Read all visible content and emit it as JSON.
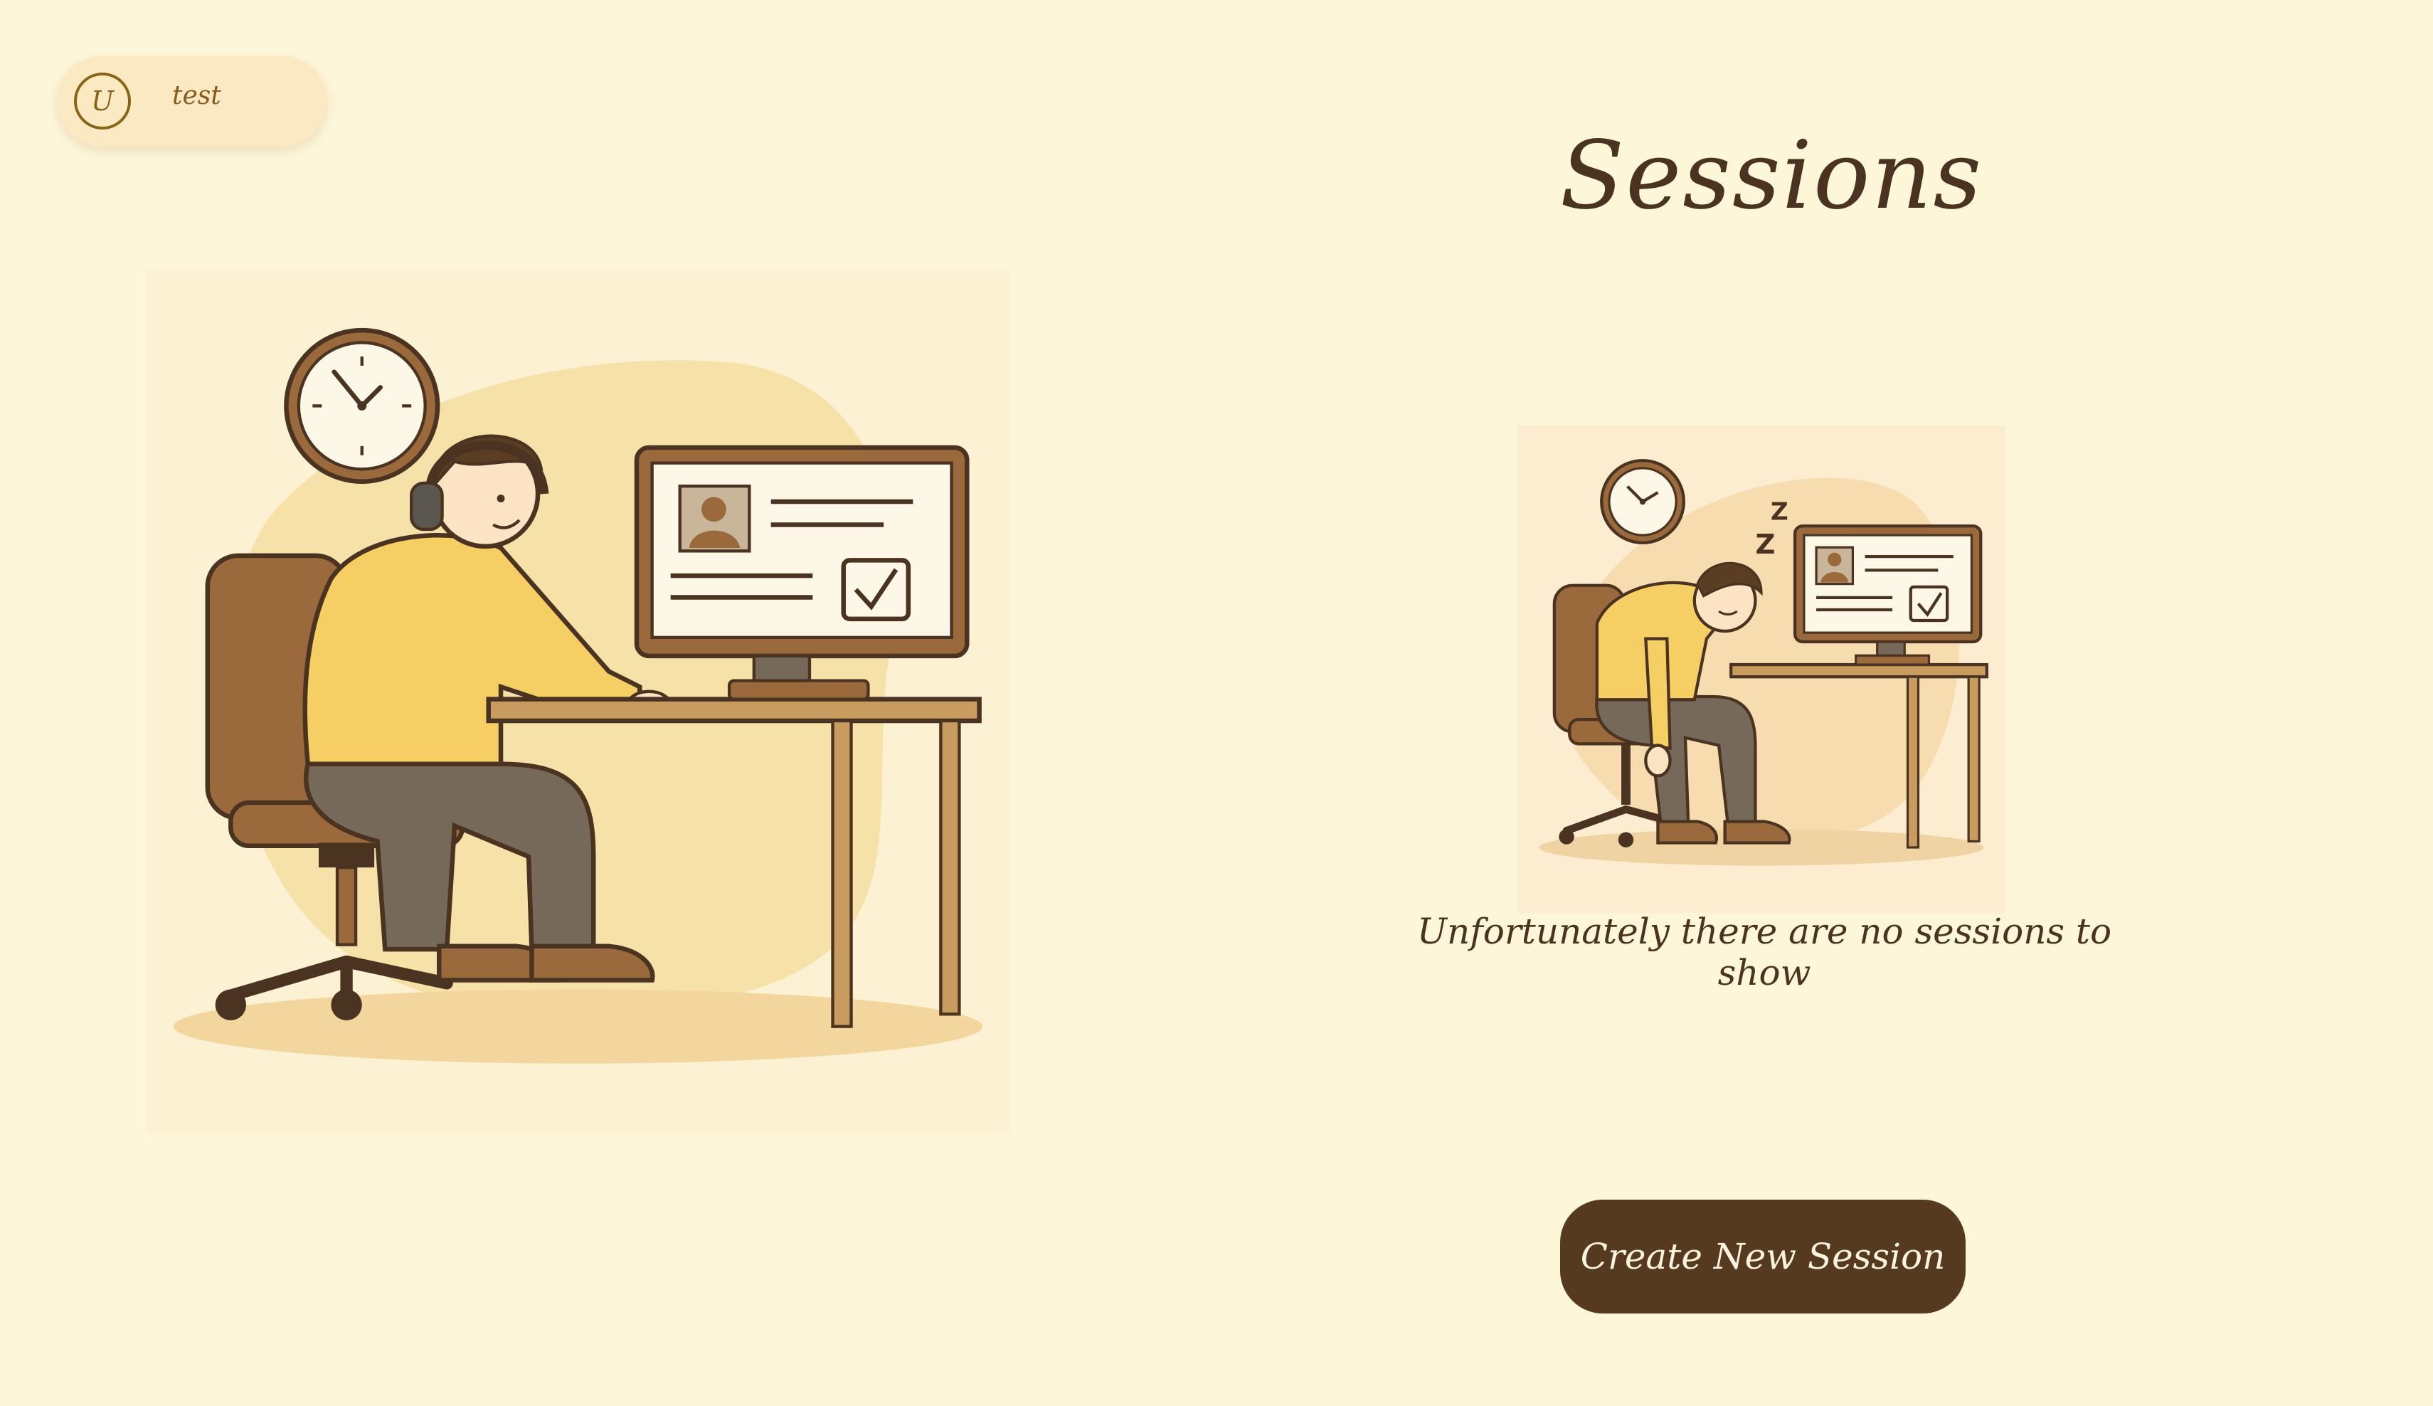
{
  "user": {
    "avatar_initial": "U",
    "name": "test"
  },
  "page": {
    "title": "Sessions",
    "empty_message": "Unfortunately there are no sessions to show",
    "create_button_label": "Create New Session"
  },
  "icons": {
    "left_illustration": "person-at-computer-illustration",
    "right_illustration": "sleeping-person-at-computer-illustration"
  },
  "colors": {
    "background": "#fdf6d9",
    "chip_background": "#fbe9c4",
    "accent_brown": "#563a1f",
    "text_dark": "#4a3320",
    "avatar_gold": "#8a6416"
  }
}
